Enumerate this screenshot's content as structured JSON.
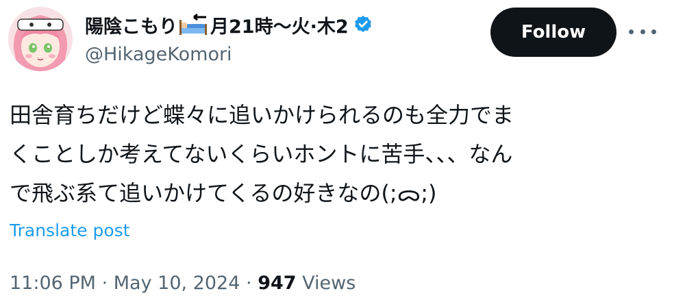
{
  "author": {
    "display_name_prefix": "陽陰こもり",
    "display_name_suffix": "月21時〜火·木2",
    "emoji_back_text": "BACK",
    "handle": "@HikageKomori",
    "verified_color": "#1d9bf0"
  },
  "actions": {
    "follow_label": "Follow"
  },
  "tweet": {
    "lines": [
      "田舎育ちだけど蝶々に追いかけられるのも全力でま",
      "くことしか考えてないくらいホントに苦手、、、なん",
      "で飛ぶ系て追いかけてくるの好きなの(;ᯅ;)"
    ],
    "translate_label": "Translate post"
  },
  "meta": {
    "time": "11:06 PM",
    "date": "May 10, 2024",
    "separator": "·",
    "views_count": "947",
    "views_label": "Views"
  }
}
